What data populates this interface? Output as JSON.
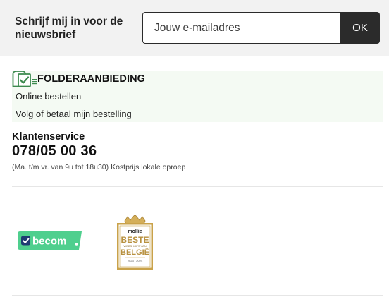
{
  "newsletter": {
    "title": "Schrijf mij in voor de nieuwsbrief",
    "email_placeholder": "Jouw e-mailadres",
    "submit_label": "OK"
  },
  "links": {
    "folder_label": "FOLDERAANBIEDING",
    "folder_icon": "folder-check-icon",
    "online_order": "Online bestellen",
    "track_order": "Volg of betaal mijn bestelling"
  },
  "customer_service": {
    "title": "Klantenservice",
    "phone": "078/05 00 36",
    "note": "(Ma. t/m vr. van 9u tot 18u30) Kostprijs lokale oproep"
  },
  "badges": {
    "becom": {
      "name": "becom",
      "color": "#4fcf8e"
    },
    "mollie": {
      "brand": "mollie",
      "line1": "BESTE",
      "line2": "WEBSHOPS VAN",
      "line3": "BELGIË",
      "years": "2023 · 2024",
      "color": "#c9a24a"
    }
  },
  "colors": {
    "button_bg": "#2b2b2b",
    "newsletter_bg": "#f2f2f2",
    "links_bg": "#f4faf3",
    "accent_green": "#4fcf8e"
  }
}
